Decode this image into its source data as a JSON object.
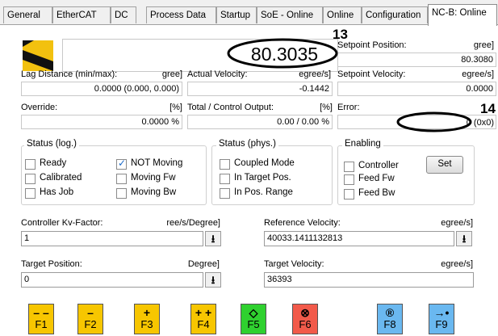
{
  "tabs": [
    "General",
    "EtherCAT",
    "DC",
    "Process Data",
    "Startup",
    "SoE - Online",
    "Online",
    "Configuration",
    "NC-B: Online"
  ],
  "annotations": {
    "big_value": "80.3035",
    "num13": "13",
    "num14": "14"
  },
  "setpoint_position": {
    "label": "Setpoint Position:",
    "unit": "gree]",
    "value": "80.3080"
  },
  "lag_distance": {
    "label": "Lag Distance (min/max):",
    "unit": "gree]",
    "value": "0.0000  (0.000, 0.000)"
  },
  "actual_velocity": {
    "label": "Actual Velocity:",
    "unit": "egree/s]",
    "value": "-0.1442"
  },
  "setpoint_velocity": {
    "label": "Setpoint Velocity:",
    "unit": "egree/s]",
    "value": "0.0000"
  },
  "override": {
    "label": "Override:",
    "unit": "[%]",
    "value": "0.0000 %"
  },
  "total_output": {
    "label": "Total / Control Output:",
    "unit": "[%]",
    "value": "0.00 /  0.00 %"
  },
  "error": {
    "label": "Error:",
    "value": "0 (0x0)"
  },
  "status_log": {
    "title": "Status (log.)",
    "ready": "Ready",
    "calibrated": "Calibrated",
    "has_job": "Has Job",
    "not_moving": "NOT Moving",
    "moving_fw": "Moving Fw",
    "moving_bw": "Moving Bw"
  },
  "status_phys": {
    "title": "Status (phys.)",
    "coupled": "Coupled Mode",
    "in_target": "In Target Pos.",
    "in_range": "In Pos. Range"
  },
  "enabling": {
    "title": "Enabling",
    "controller": "Controller",
    "feed_fw": "Feed Fw",
    "feed_bw": "Feed Bw",
    "set": "Set"
  },
  "kv": {
    "label": "Controller Kv-Factor:",
    "unit": "ree/s/Degree]",
    "value": "1"
  },
  "ref_velocity": {
    "label": "Reference Velocity:",
    "unit": "egree/s]",
    "value": "40033.1411132813"
  },
  "target_position": {
    "label": "Target Position:",
    "unit": "Degree]",
    "value": "0"
  },
  "target_velocity": {
    "label": "Target Velocity:",
    "unit": "egree/s]",
    "value": "36393"
  },
  "fkeys": [
    {
      "sym": "– –",
      "label": "F1",
      "color": "#f7c600"
    },
    {
      "sym": "–",
      "label": "F2",
      "color": "#f7c600"
    },
    {
      "sym": "+",
      "label": "F3",
      "color": "#f7c600"
    },
    {
      "sym": "+ +",
      "label": "F4",
      "color": "#f7c600"
    },
    {
      "sym": "◇",
      "label": "F5",
      "color": "#2fd12f"
    },
    {
      "sym": "⊗",
      "label": "F6",
      "color": "#f25a4a"
    },
    {
      "sym": "®",
      "label": "F8",
      "color": "#6ab8f0"
    },
    {
      "sym": "→•",
      "label": "F9",
      "color": "#6ab8f0"
    }
  ]
}
